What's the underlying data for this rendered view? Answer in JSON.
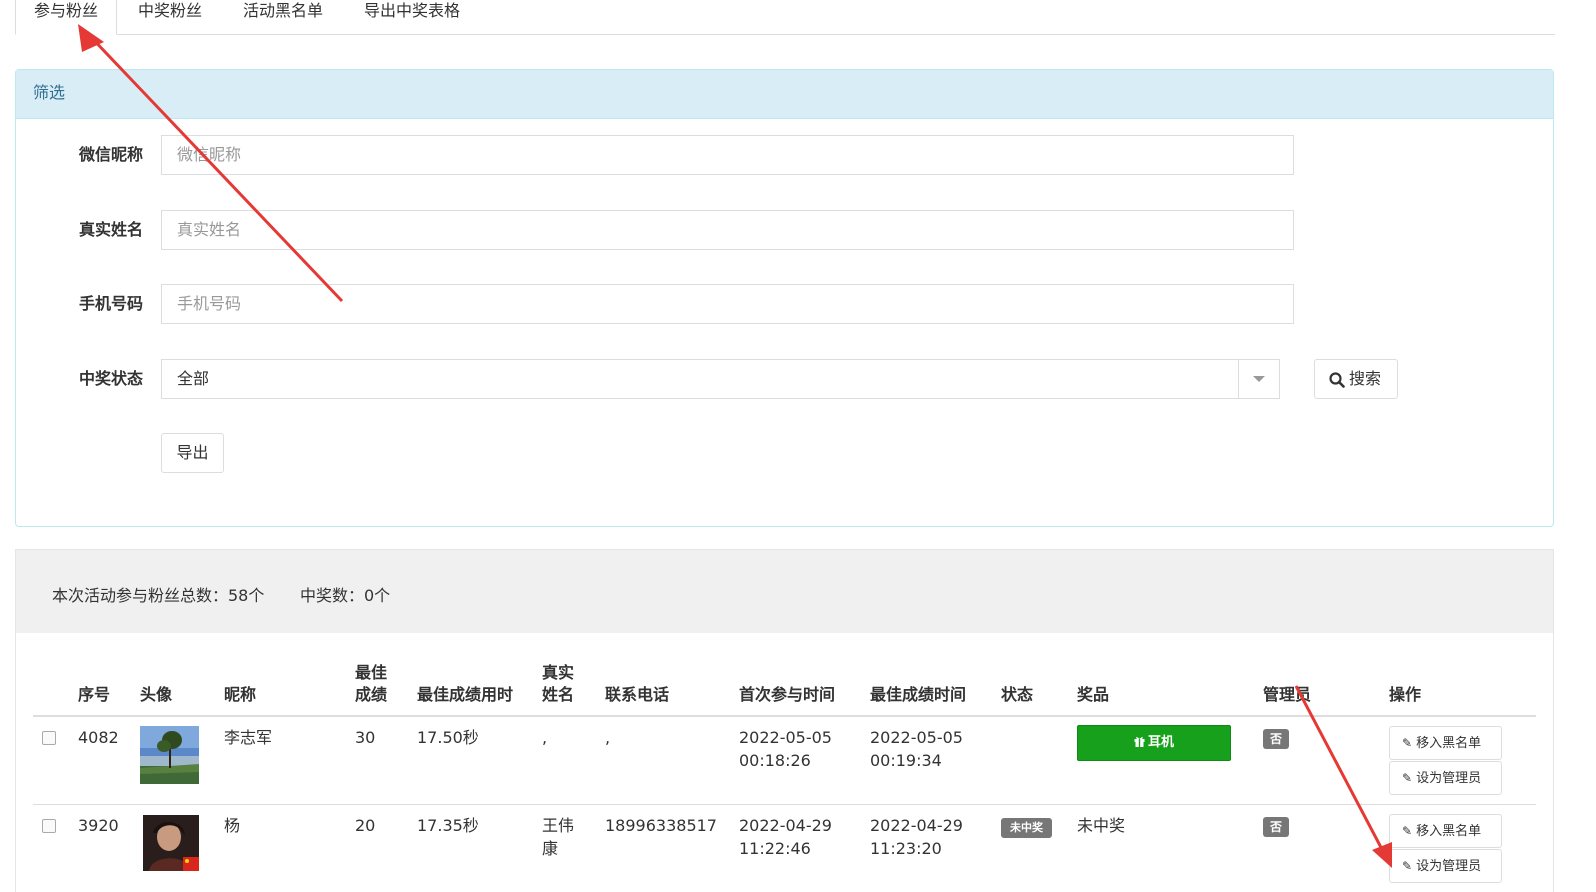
{
  "tabs": [
    {
      "label": "参与粉丝"
    },
    {
      "label": "中奖粉丝"
    },
    {
      "label": "活动黑名单"
    },
    {
      "label": "导出中奖表格"
    }
  ],
  "filter": {
    "title": "筛选",
    "nickname_label": "微信昵称",
    "nickname_placeholder": "微信昵称",
    "realname_label": "真实姓名",
    "realname_placeholder": "真实姓名",
    "phone_label": "手机号码",
    "phone_placeholder": "手机号码",
    "status_label": "中奖状态",
    "status_value": "全部",
    "search_label": "搜索",
    "export_label": "导出"
  },
  "summary": {
    "total_text": "本次活动参与粉丝总数：58个",
    "winners_text": "中奖数：0个"
  },
  "table": {
    "headers": {
      "id": "序号",
      "avatar": "头像",
      "nickname": "昵称",
      "best_score_1": "最佳",
      "best_score_2": "成绩",
      "best_time": "最佳成绩用时",
      "real_name_1": "真实",
      "real_name_2": "姓名",
      "phone": "联系电话",
      "first_join": "首次参与时间",
      "best_score_time": "最佳成绩时间",
      "status": "状态",
      "prize": "奖品",
      "admin": "管理员",
      "actions": "操作"
    },
    "rows": [
      {
        "id": "4082",
        "nickname": "李志军",
        "score": "30",
        "duration": "17.50秒",
        "real_name_1": ",",
        "real_name_2": "",
        "phone": ",",
        "first_date": "2022-05-05",
        "first_time": "00:18:26",
        "best_date": "2022-05-05",
        "best_time": "00:19:34",
        "status": "",
        "prize": "耳机",
        "admin": "否",
        "blacklist_label": "移入黑名单",
        "set_admin_label": "设为管理员"
      },
      {
        "id": "3920",
        "nickname": "杨",
        "score": "20",
        "duration": "17.35秒",
        "real_name_1": "王伟",
        "real_name_2": "康",
        "phone": "18996338517",
        "first_date": "2022-04-29",
        "first_time": "11:22:46",
        "best_date": "2022-04-29",
        "best_time": "11:23:20",
        "status": "未中奖",
        "prize": "未中奖",
        "admin": "否",
        "blacklist_label": "移入黑名单",
        "set_admin_label": "设为管理员"
      }
    ]
  },
  "icons": {
    "search": "search-icon",
    "gift": "gift-icon",
    "edit": "edit-icon",
    "caret": "caret-down-icon"
  },
  "colors": {
    "panel_header_bg": "#d9edf7",
    "panel_border": "#bce8f1",
    "prize_green": "#16a01b",
    "badge_gray": "#777777",
    "annotation_red": "#e53935"
  }
}
